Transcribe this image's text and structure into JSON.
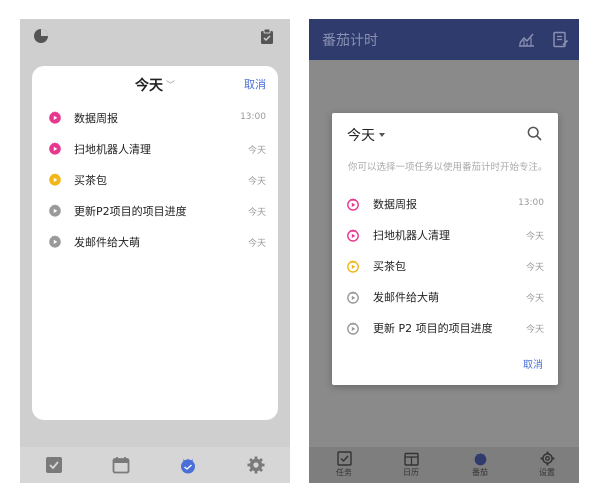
{
  "left": {
    "title": "今天",
    "cancel_label": "取消",
    "tasks": [
      {
        "name": "数据周报",
        "time": "13:00",
        "color": "#e8378e"
      },
      {
        "name": "扫地机器人清理",
        "time": "今天",
        "color": "#e8378e"
      },
      {
        "name": "买茶包",
        "time": "今天",
        "color": "#f2b619"
      },
      {
        "name": "更新P2项目的项目进度",
        "time": "今天",
        "color": "#9a9a9a"
      },
      {
        "name": "发邮件给大萌",
        "time": "今天",
        "color": "#9a9a9a"
      }
    ],
    "tabbar": [
      "checkbox-icon",
      "calendar-icon",
      "pomodoro-icon",
      "gear-icon"
    ]
  },
  "right": {
    "app_title": "番茄计时",
    "title": "今天",
    "description": "你可以选择一项任务以使用番茄计时开始专注。",
    "cancel_label": "取消",
    "tasks": [
      {
        "name": "数据周报",
        "time": "13:00",
        "color": "#e8378e"
      },
      {
        "name": "扫地机器人清理",
        "time": "今天",
        "color": "#e8378e"
      },
      {
        "name": "买茶包",
        "time": "今天",
        "color": "#f2b619"
      },
      {
        "name": "发邮件给大萌",
        "time": "今天",
        "color": "#9a9a9a"
      },
      {
        "name": "更新 P2 项目的项目进度",
        "time": "今天",
        "color": "#9a9a9a"
      }
    ],
    "tabs": [
      {
        "label": "任务"
      },
      {
        "label": "日历"
      },
      {
        "label": "番茄"
      },
      {
        "label": "设置"
      }
    ]
  },
  "colors": {
    "accent": "#4a6fd8",
    "header": "#2f3a6d",
    "active_tab": "#2f3a6d"
  }
}
